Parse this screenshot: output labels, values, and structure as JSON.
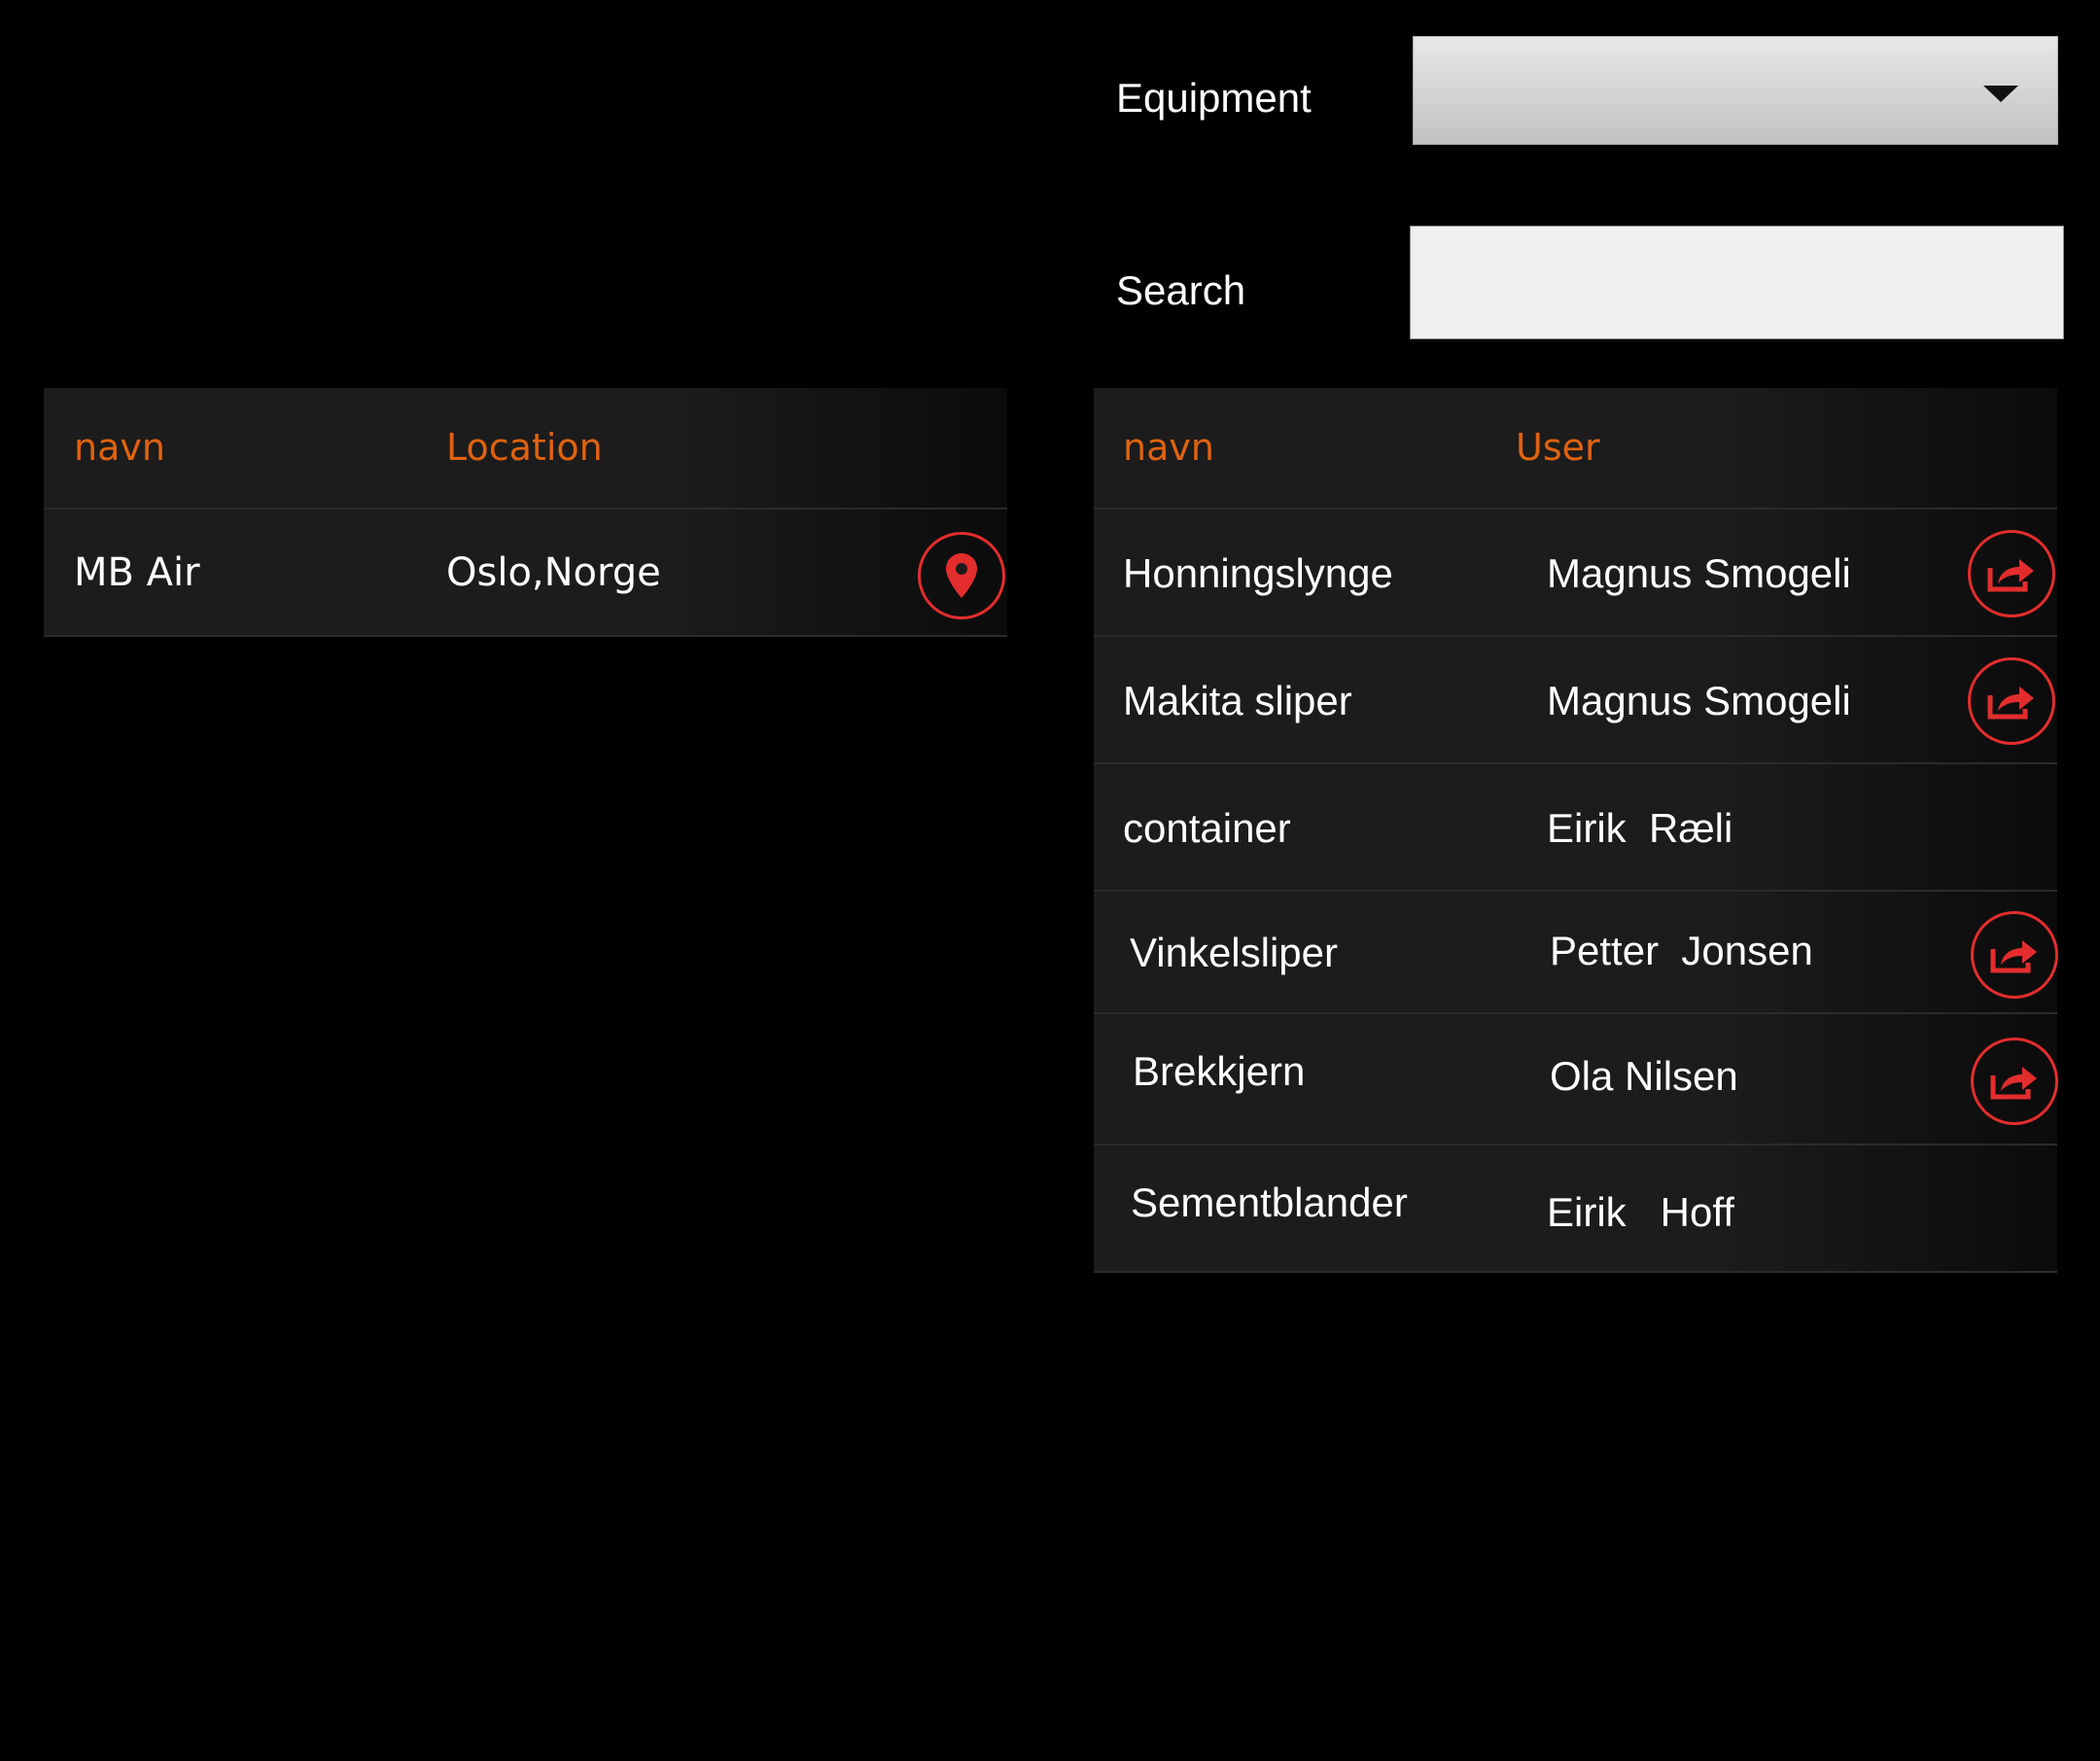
{
  "filters": {
    "equipment_label": "Equipment",
    "equipment_selected": "",
    "search_label": "Search",
    "search_value": ""
  },
  "locations_table": {
    "headers": [
      "navn",
      "Location"
    ],
    "rows": [
      {
        "name": "MB Air",
        "location": "Oslo,Norge",
        "action_icon": "location-pin-icon"
      }
    ]
  },
  "equipment_table": {
    "headers": [
      "navn",
      "User"
    ],
    "rows": [
      {
        "name": "Honningslynge",
        "user": "Magnus Smogeli",
        "action_icon": "share-icon"
      },
      {
        "name": "Makita sliper",
        "user": "Magnus Smogeli",
        "action_icon": "share-icon"
      },
      {
        "name": "container",
        "user": "Eirik  Ræli",
        "action_icon": ""
      },
      {
        "name": "Vinkelsliper",
        "user": "Petter  Jonsen",
        "action_icon": "share-icon"
      },
      {
        "name": "Brekkjern",
        "user": "Ola Nilsen",
        "action_icon": "share-icon"
      },
      {
        "name": "Sementblander",
        "user": "Eirik   Hoff",
        "action_icon": ""
      }
    ]
  },
  "colors": {
    "accent_header": "#e0620f",
    "icon_red": "#e32d2d",
    "row_bg": "#1c1c1c",
    "page_bg": "#000000"
  }
}
